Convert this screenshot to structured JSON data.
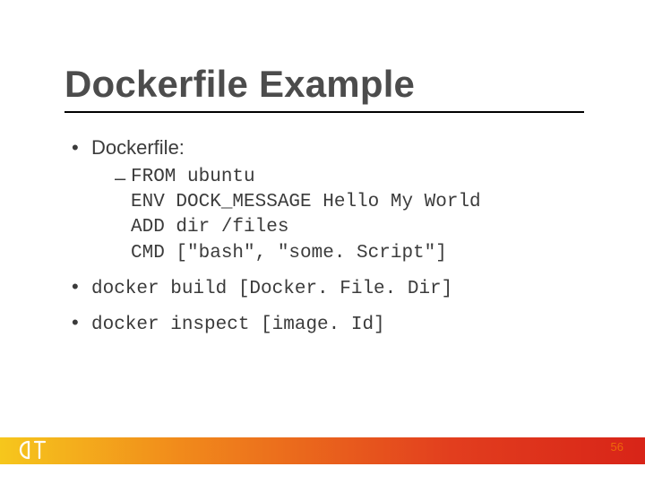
{
  "title": "Dockerfile Example",
  "bullets": {
    "b0": {
      "label": "Dockerfile:",
      "code": "FROM ubuntu\nENV DOCK_MESSAGE Hello My World\nADD dir /files\nCMD [\"bash\", \"some. Script\"]"
    },
    "b1": {
      "text": "docker build [Docker. File. Dir]"
    },
    "b2": {
      "text": "docker inspect [image. Id]"
    }
  },
  "page_number": "56",
  "logo_name": "ST"
}
